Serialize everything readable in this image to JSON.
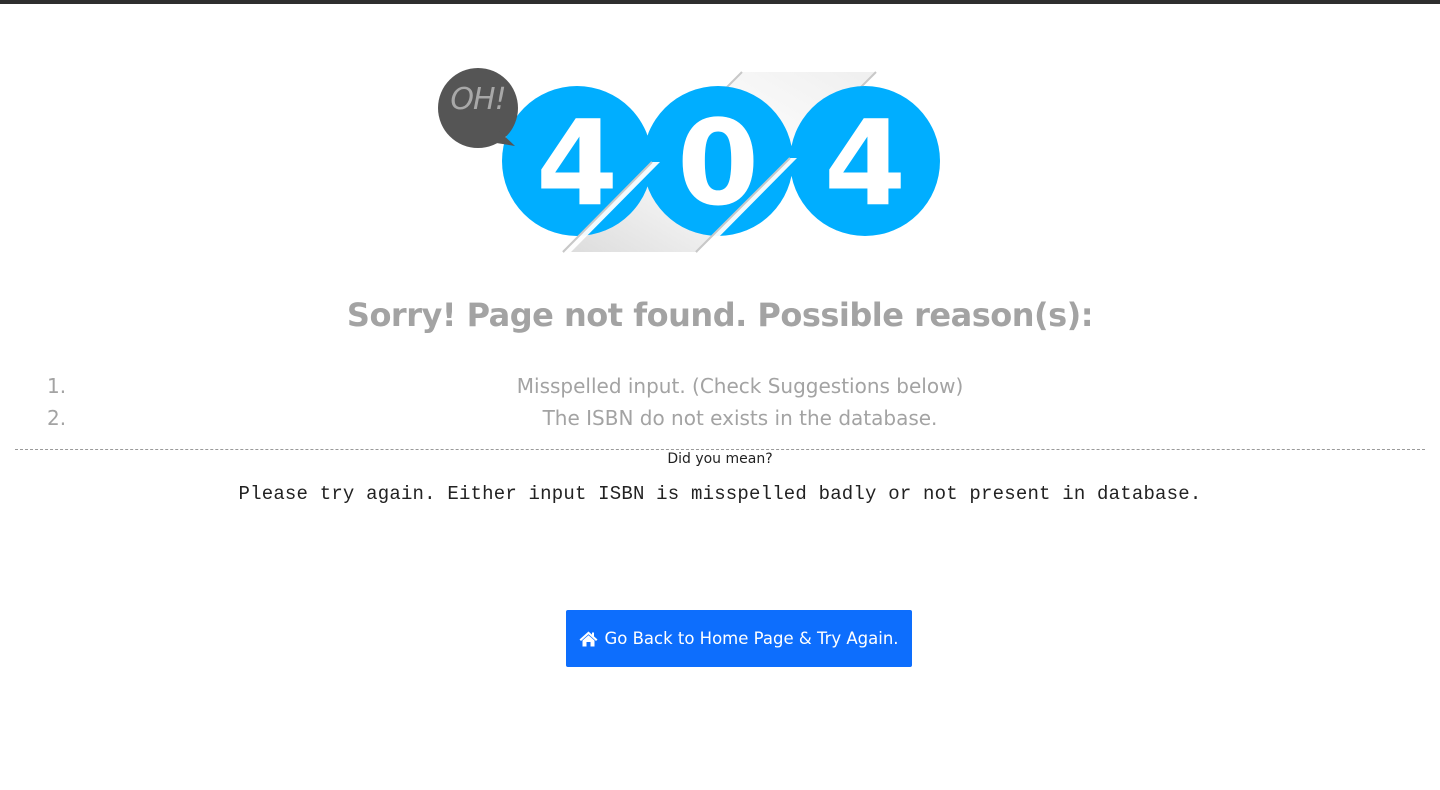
{
  "hero": {
    "bubble": "OH!",
    "digits": [
      "4",
      "0",
      "4"
    ],
    "colors": {
      "circle": "#00aeff",
      "bubble": "#555555",
      "bubble_text": "#a8a8a8"
    }
  },
  "headline": "Sorry! Page not found. Possible reason(s):",
  "reasons": [
    {
      "number": "1.",
      "text": "Misspelled input. (Check Suggestions below)"
    },
    {
      "number": "2.",
      "text": "The ISBN do not exists in the database."
    }
  ],
  "suggestions": {
    "label": "Did you mean?",
    "message": "Please try again. Either input ISBN is misspelled badly or not present in database."
  },
  "button": {
    "label": "Go Back to Home Page & Try Again.",
    "icon": "home-icon",
    "color": "#0d6efd"
  }
}
